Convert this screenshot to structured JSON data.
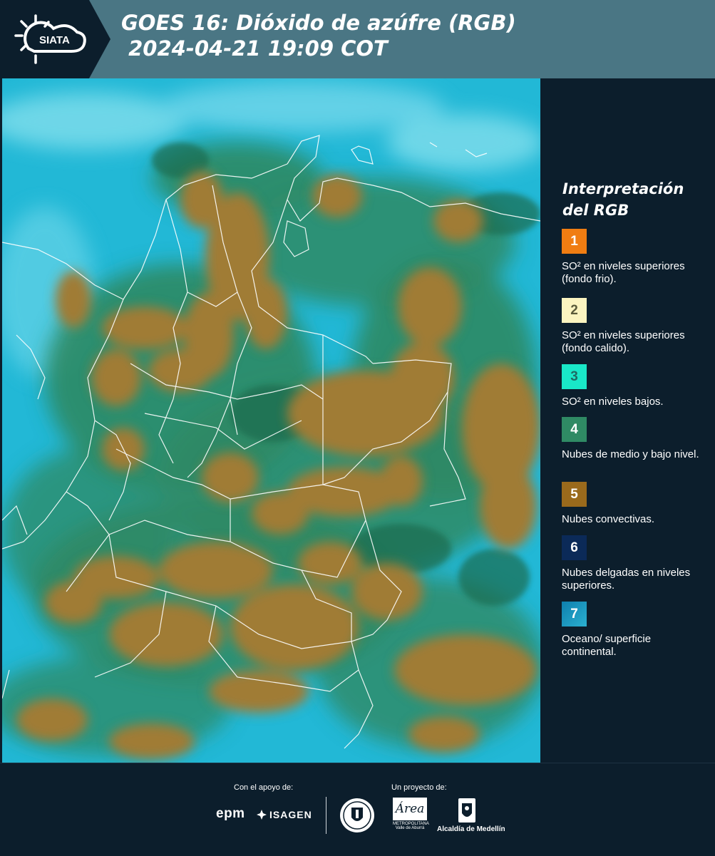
{
  "header": {
    "logo_text": "SIATA",
    "title_line1": "GOES 16: Dióxido de azúfre (RGB)",
    "title_line2": " 2024-04-21 19:09 COT"
  },
  "legend": {
    "title": "Interpretación del RGB",
    "items": [
      {
        "number": "1",
        "color": "#f07d12",
        "label": "SO² en niveles superiores (fondo frio)."
      },
      {
        "number": "2",
        "color": "#fbf4c0",
        "label": "SO² en niveles superiores (fondo calido)."
      },
      {
        "number": "3",
        "color": "#19e8c8",
        "label": "SO² en niveles bajos."
      },
      {
        "number": "4",
        "color": "#2f8a64",
        "label": "Nubes de medio y bajo nivel."
      },
      {
        "number": "5",
        "color": "#9a6a1c",
        "label": "Nubes convectivas."
      },
      {
        "number": "6",
        "color": "#0b2a58",
        "label": "Nubes delgadas en niveles superiores."
      },
      {
        "number": "7",
        "color": "#1a8cb4",
        "label": "Oceano/ superficie continental."
      }
    ]
  },
  "footer": {
    "support_label": "Con el apoyo de:",
    "project_label": "Un proyecto de:",
    "sponsor_epm": "epm",
    "sponsor_isagen": "ISAGEN",
    "sponsor_medellin_seal": "MEDELLÍN",
    "sponsor_area": "Área",
    "sponsor_area_sub": "METROPOLITANA",
    "sponsor_area_sub2": "Valle de Aburrá",
    "sponsor_alcaldia": "Alcaldía de Medellín"
  },
  "colors": {
    "header_bg": "#4a7684",
    "page_bg": "#0c1e2c",
    "ocean": "#22b8d6",
    "cloud_brown": "#9a7a32",
    "land_green": "#2f8a64"
  }
}
